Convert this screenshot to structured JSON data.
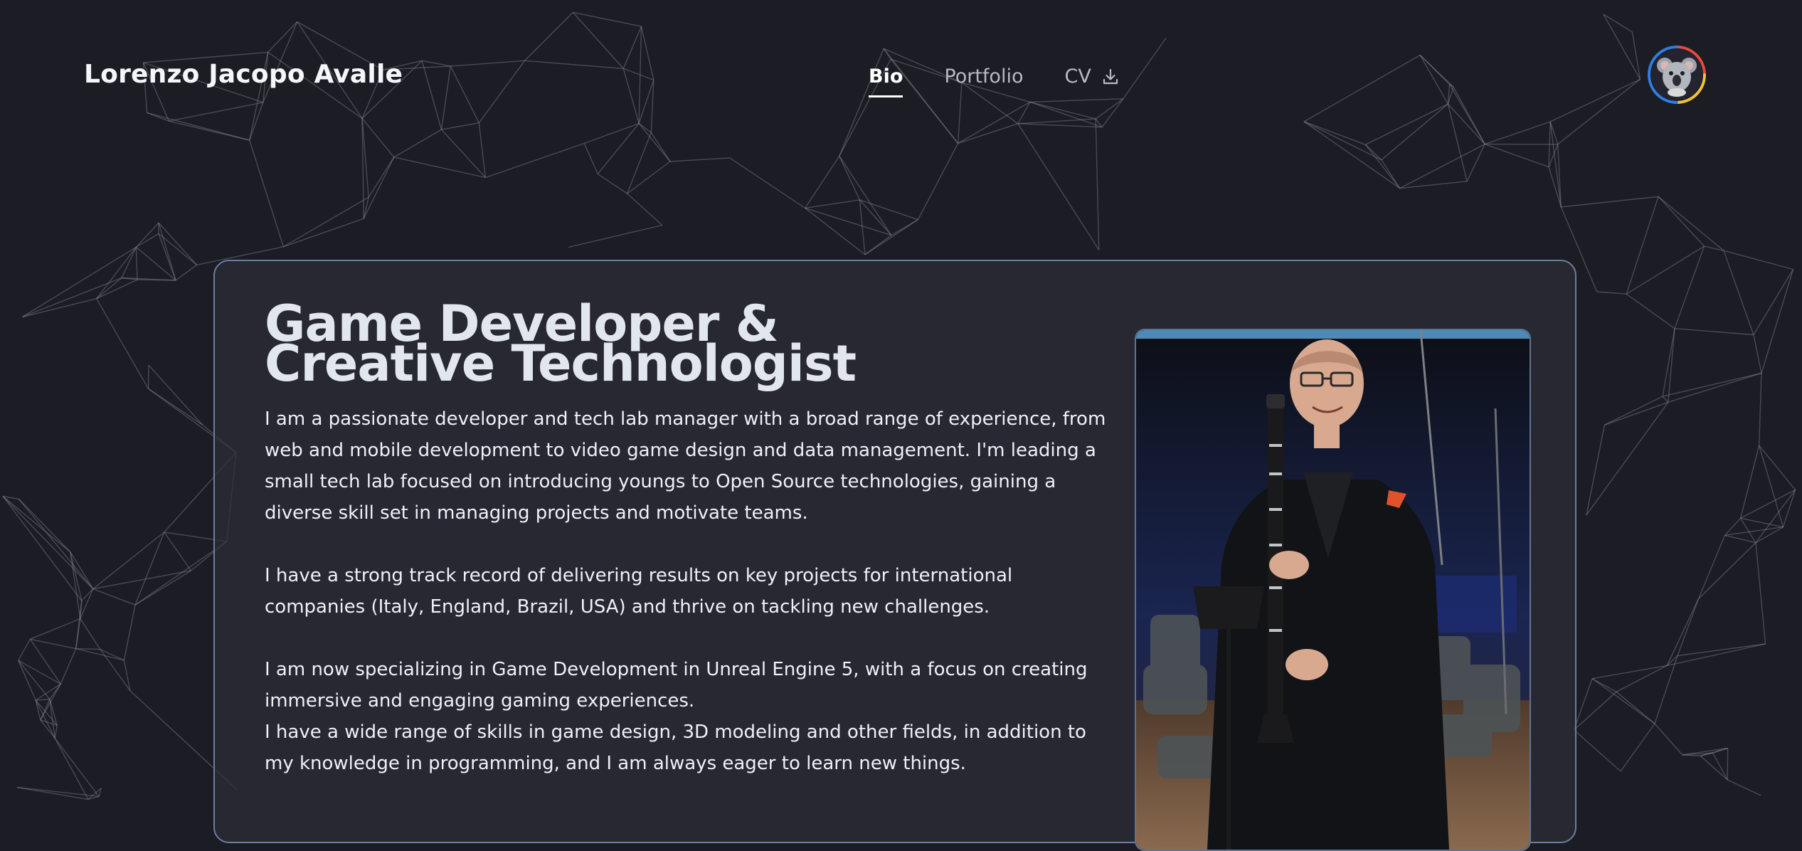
{
  "header": {
    "brand": "Lorenzo Jacopo Avalle",
    "nav": [
      {
        "label": "Bio",
        "active": true
      },
      {
        "label": "Portfolio",
        "active": false
      },
      {
        "label": "CV",
        "active": false
      }
    ]
  },
  "hero": {
    "headline_line1": "Game Developer &",
    "headline_line2": "Creative Technologist",
    "paragraphs": [
      "I am a passionate developer and tech lab manager with a broad range of experience, from web and mobile development to video game design and data management. I'm leading a small tech lab focused on introducing youngs to Open Source technologies, gaining a diverse skill set in managing projects and motivate teams.",
      "I have a strong track record of delivering results on key projects for international companies (Italy, England, Brazil, USA) and thrive on tackling new challenges.",
      "I am now specializing in Game Development in Unreal Engine 5, with a focus on creating immersive and engaging gaming experiences.",
      "I have a wide range of skills in game design, 3D modeling and other fields, in addition to my knowledge in programming, and I am always eager to learn new things."
    ]
  },
  "icons": {
    "cv": "download-icon",
    "avatar": "koala-avatar-icon"
  },
  "colors": {
    "background": "#1b1c24",
    "card_border": "#6c7e9d",
    "avatar_ring": [
      "#2f7de1",
      "#e34b3c",
      "#f1c232"
    ]
  }
}
